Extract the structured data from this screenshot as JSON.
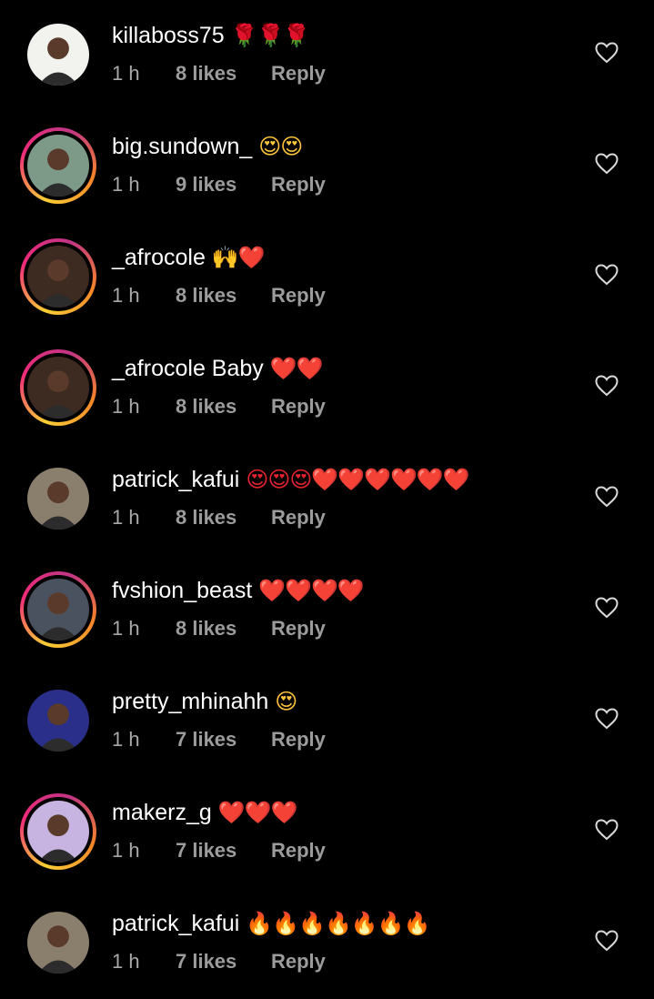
{
  "comments": [
    {
      "username": "killaboss75",
      "text": "",
      "emoji": "🌹🌹🌹",
      "emoji_color": "#e8232f",
      "time": "1 h",
      "likes": "8 likes",
      "reply": "Reply",
      "ring": false,
      "avatar_bg": "#f2f2ee"
    },
    {
      "username": "big.sundown_",
      "text": "",
      "emoji": "😍😍",
      "emoji_color": "#ffc53b",
      "time": "1 h",
      "likes": "9 likes",
      "reply": "Reply",
      "ring": true,
      "avatar_bg": "#7d9a88"
    },
    {
      "username": "_afrocole",
      "text": "",
      "emoji": "🙌❤️",
      "emoji_color": "#e8232f",
      "time": "1 h",
      "likes": "8 likes",
      "reply": "Reply",
      "ring": true,
      "avatar_bg": "#3d2a20"
    },
    {
      "username": "_afrocole",
      "text": " Baby",
      "emoji": "❤️❤️",
      "emoji_color": "#e8232f",
      "time": "1 h",
      "likes": "8 likes",
      "reply": "Reply",
      "ring": true,
      "avatar_bg": "#3d2a20"
    },
    {
      "username": "patrick_kafui",
      "text": "",
      "emoji": "😍😍😍❤️❤️❤️❤️❤️❤️",
      "emoji_color": "#e8232f",
      "time": "1 h",
      "likes": "8 likes",
      "reply": "Reply",
      "ring": false,
      "avatar_bg": "#8a7e6c"
    },
    {
      "username": "fvshion_beast",
      "text": "",
      "emoji": "❤️❤️❤️❤️",
      "emoji_color": "#e8232f",
      "time": "1 h",
      "likes": "8 likes",
      "reply": "Reply",
      "ring": true,
      "avatar_bg": "#4a5260"
    },
    {
      "username": "pretty_mhinahh",
      "text": "",
      "emoji": "😍",
      "emoji_color": "#ffc53b",
      "time": "1 h",
      "likes": "7 likes",
      "reply": "Reply",
      "ring": false,
      "avatar_bg": "#2a2f8a"
    },
    {
      "username": "makerz_g",
      "text": "",
      "emoji": "❤️❤️❤️",
      "emoji_color": "#e8232f",
      "time": "1 h",
      "likes": "7 likes",
      "reply": "Reply",
      "ring": true,
      "avatar_bg": "#c7b4e0"
    },
    {
      "username": "patrick_kafui",
      "text": "",
      "emoji": "🔥🔥🔥🔥🔥🔥🔥",
      "emoji_color": "#ff6a1a",
      "time": "1 h",
      "likes": "7 likes",
      "reply": "Reply",
      "ring": false,
      "avatar_bg": "#8a7e6c"
    }
  ],
  "icons": {
    "like": "heart-outline-icon"
  },
  "colors": {
    "background": "#000000",
    "text": "#ffffff",
    "meta": "#a8a8a8"
  }
}
